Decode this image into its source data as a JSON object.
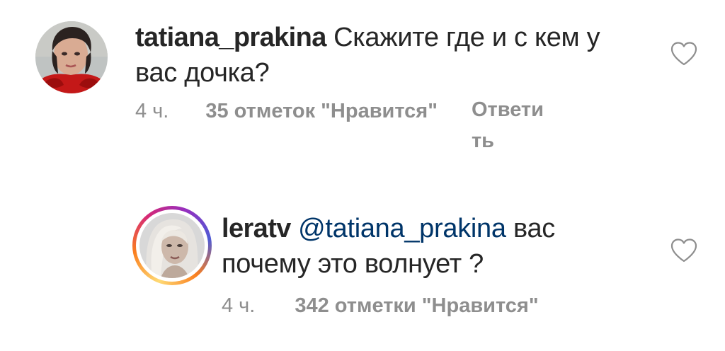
{
  "comments": [
    {
      "username": "tatiana_prakina",
      "text": "Скажите где и с кем у вас дочка?",
      "time": "4 ч.",
      "likes": "35 отметок \"Нравится\"",
      "reply_label": "Ответить",
      "reply_line1": "Ответи",
      "reply_line2": "ть",
      "avatar": "user-photo",
      "like_icon": "heart-outline-icon"
    },
    {
      "username": "leratv",
      "mention": "@tatiana_prakina",
      "text": "вас почему это волнует ?",
      "time": "4 ч.",
      "likes": "342 отметки \"Нравится\"",
      "avatar": "story-ring-user-photo",
      "like_icon": "heart-outline-icon"
    }
  ],
  "colors": {
    "text": "#262626",
    "meta": "#8e8e8e",
    "mention": "#003569",
    "story_ring": [
      "#feda75",
      "#fa7e1e",
      "#d62976",
      "#962fbf"
    ]
  }
}
